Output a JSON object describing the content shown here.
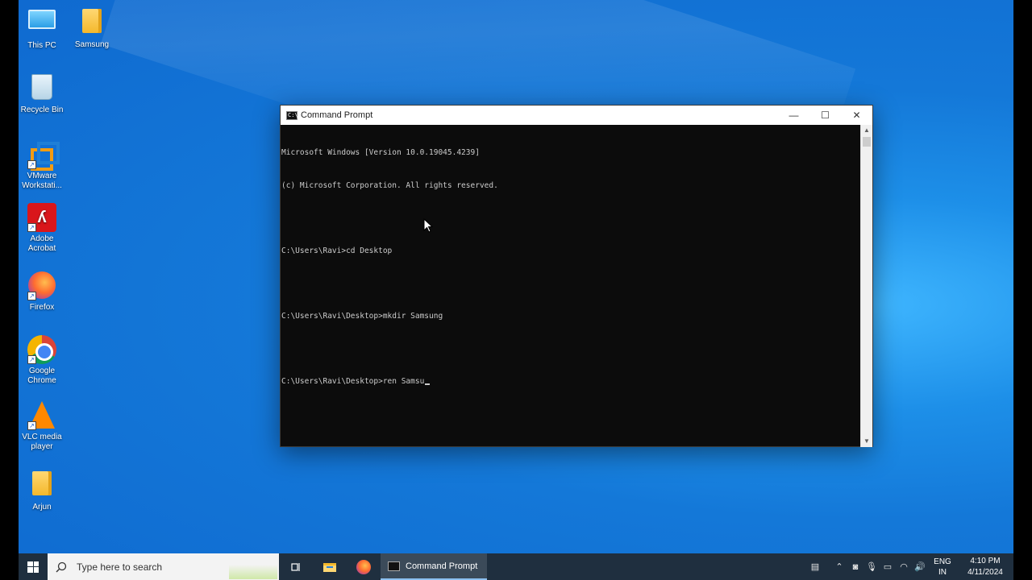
{
  "desktop": {
    "icons": [
      {
        "label": "This PC",
        "kind": "pc-icon"
      },
      {
        "label": "Samsung",
        "kind": "folder-icon"
      },
      {
        "label": "Recycle Bin",
        "kind": "recycle-bin-icon"
      },
      {
        "label": "VMware Workstati...",
        "kind": "vmware-icon"
      },
      {
        "label": "Adobe Acrobat",
        "kind": "acrobat-icon"
      },
      {
        "label": "Firefox",
        "kind": "firefox-icon"
      },
      {
        "label": "Google Chrome",
        "kind": "chrome-icon"
      },
      {
        "label": "VLC media player",
        "kind": "vlc-icon"
      },
      {
        "label": "Arjun",
        "kind": "folder-icon"
      }
    ]
  },
  "window": {
    "title": "Command Prompt",
    "icon_glyph": "C:\\",
    "buttons": {
      "minimize": "—",
      "maximize": "☐",
      "close": "✕"
    },
    "lines": [
      "Microsoft Windows [Version 10.0.19045.4239]",
      "(c) Microsoft Corporation. All rights reserved.",
      "",
      "C:\\Users\\Ravi>cd Desktop",
      "",
      "C:\\Users\\Ravi\\Desktop>mkdir Samsung",
      "",
      "C:\\Users\\Ravi\\Desktop>ren Samsu"
    ],
    "scroll_up": "▲",
    "scroll_down": "▼"
  },
  "taskbar": {
    "search_placeholder": "Type here to search",
    "active_app_label": "Command Prompt",
    "tray": {
      "language_top": "ENG",
      "language_bottom": "IN",
      "time": "4:10 PM",
      "date": "4/11/2024"
    }
  },
  "colors": {
    "desktop_blue": "#1478d8",
    "console_bg": "#0c0c0c",
    "console_text": "#cccccc",
    "taskbar_bg": "#1f2f3f"
  }
}
